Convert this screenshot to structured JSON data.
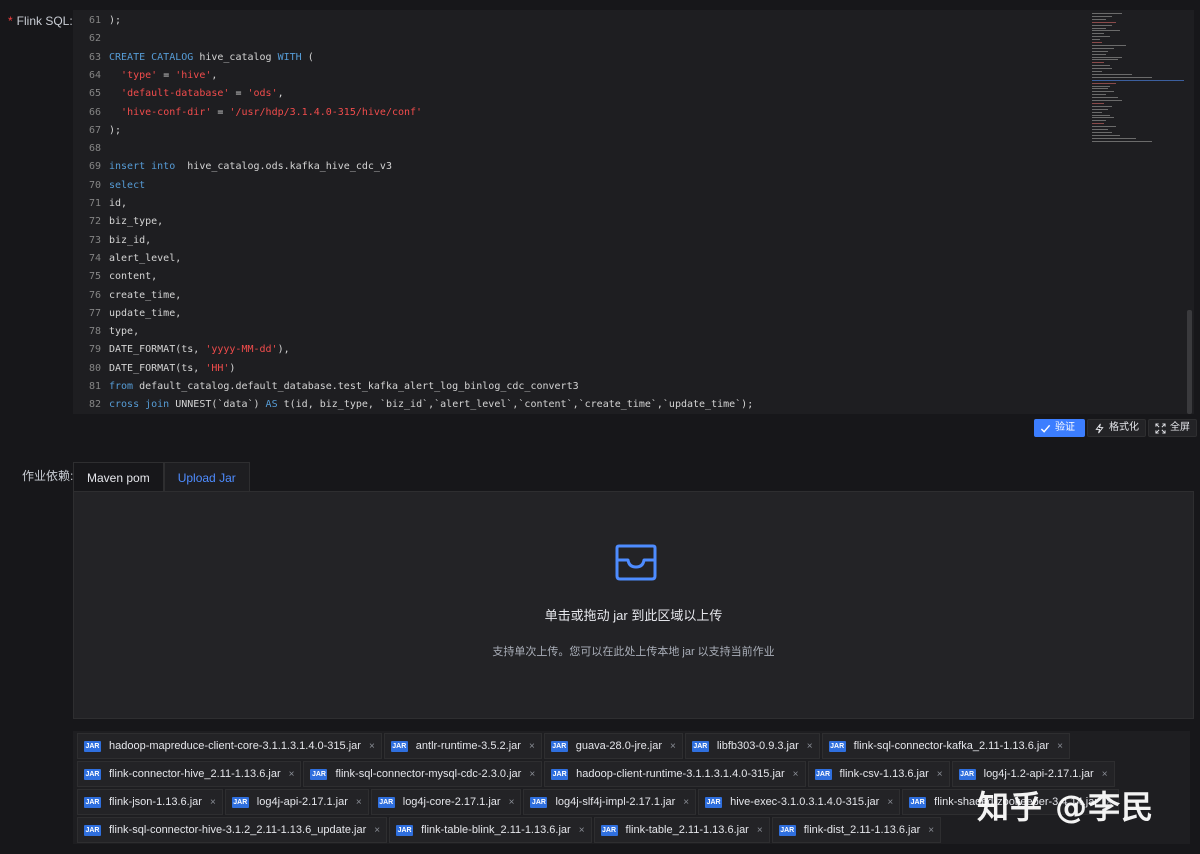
{
  "form": {
    "sql_label": "Flink SQL",
    "sql_required": "*",
    "dependency_label": "作业依赖"
  },
  "editor": {
    "lines": [
      {
        "num": "61",
        "parts": [
          {
            "t": ");",
            "c": ""
          }
        ]
      },
      {
        "num": "62",
        "parts": []
      },
      {
        "num": "63",
        "parts": [
          {
            "t": "CREATE CATALOG",
            "c": "kw"
          },
          {
            "t": " hive_catalog ",
            "c": ""
          },
          {
            "t": "WITH",
            "c": "kw"
          },
          {
            "t": " (",
            "c": ""
          }
        ]
      },
      {
        "num": "64",
        "parts": [
          {
            "t": "  ",
            "c": ""
          },
          {
            "t": "'type'",
            "c": "str"
          },
          {
            "t": " = ",
            "c": ""
          },
          {
            "t": "'hive'",
            "c": "str"
          },
          {
            "t": ",",
            "c": ""
          }
        ]
      },
      {
        "num": "65",
        "parts": [
          {
            "t": "  ",
            "c": ""
          },
          {
            "t": "'default-database'",
            "c": "str"
          },
          {
            "t": " = ",
            "c": ""
          },
          {
            "t": "'ods'",
            "c": "str"
          },
          {
            "t": ",",
            "c": ""
          }
        ]
      },
      {
        "num": "66",
        "parts": [
          {
            "t": "  ",
            "c": ""
          },
          {
            "t": "'hive-conf-dir'",
            "c": "str"
          },
          {
            "t": " = ",
            "c": ""
          },
          {
            "t": "'/usr/hdp/3.1.4.0-315/hive/conf'",
            "c": "str"
          }
        ]
      },
      {
        "num": "67",
        "parts": [
          {
            "t": ");",
            "c": ""
          }
        ]
      },
      {
        "num": "68",
        "parts": []
      },
      {
        "num": "69",
        "parts": [
          {
            "t": "insert into",
            "c": "kw"
          },
          {
            "t": "  hive_catalog.ods.kafka_hive_cdc_v3",
            "c": ""
          }
        ]
      },
      {
        "num": "70",
        "parts": [
          {
            "t": "select",
            "c": "kw"
          }
        ]
      },
      {
        "num": "71",
        "parts": [
          {
            "t": "id,",
            "c": ""
          }
        ]
      },
      {
        "num": "72",
        "parts": [
          {
            "t": "biz_type,",
            "c": ""
          }
        ]
      },
      {
        "num": "73",
        "parts": [
          {
            "t": "biz_id,",
            "c": ""
          }
        ]
      },
      {
        "num": "74",
        "parts": [
          {
            "t": "alert_level,",
            "c": ""
          }
        ]
      },
      {
        "num": "75",
        "parts": [
          {
            "t": "content,",
            "c": ""
          }
        ]
      },
      {
        "num": "76",
        "parts": [
          {
            "t": "create_time,",
            "c": ""
          }
        ]
      },
      {
        "num": "77",
        "parts": [
          {
            "t": "update_time,",
            "c": ""
          }
        ]
      },
      {
        "num": "78",
        "parts": [
          {
            "t": "type,",
            "c": ""
          }
        ]
      },
      {
        "num": "79",
        "parts": [
          {
            "t": "DATE_FORMAT(ts, ",
            "c": ""
          },
          {
            "t": "'yyyy-MM-dd'",
            "c": "str"
          },
          {
            "t": "),",
            "c": ""
          }
        ]
      },
      {
        "num": "80",
        "parts": [
          {
            "t": "DATE_FORMAT(ts, ",
            "c": ""
          },
          {
            "t": "'HH'",
            "c": "str"
          },
          {
            "t": ")",
            "c": ""
          }
        ]
      },
      {
        "num": "81",
        "parts": [
          {
            "t": "from",
            "c": "kw"
          },
          {
            "t": " default_catalog.default_database.test_kafka_alert_log_binlog_cdc_convert3",
            "c": ""
          }
        ]
      },
      {
        "num": "82",
        "parts": [
          {
            "t": "cross join",
            "c": "kw"
          },
          {
            "t": " UNNEST(`data`) ",
            "c": ""
          },
          {
            "t": "AS",
            "c": "kw"
          },
          {
            "t": " t(id, biz_type, `biz_id`,`alert_level`,`content`,`create_time`,`update_time`);",
            "c": ""
          }
        ]
      }
    ]
  },
  "actions": {
    "validate": "验证",
    "format": "格式化",
    "fullscreen": "全屏"
  },
  "tabs": [
    {
      "label": "Maven pom",
      "active": false
    },
    {
      "label": "Upload Jar",
      "active": true
    }
  ],
  "dropzone": {
    "title": "单击或拖动 jar 到此区域以上传",
    "hint": "支持单次上传。您可以在此处上传本地 jar 以支持当前作业"
  },
  "jar_badge": "JAR",
  "files": [
    [
      "hadoop-mapreduce-client-core-3.1.1.3.1.4.0-315.jar",
      "antlr-runtime-3.5.2.jar",
      "guava-28.0-jre.jar",
      "libfb303-0.9.3.jar",
      "flink-sql-connector-kafka_2.11-1.13.6.jar"
    ],
    [
      "flink-connector-hive_2.11-1.13.6.jar",
      "flink-sql-connector-mysql-cdc-2.3.0.jar",
      "hadoop-client-runtime-3.1.1.3.1.4.0-315.jar",
      "flink-csv-1.13.6.jar",
      "log4j-1.2-api-2.17.1.jar"
    ],
    [
      "flink-json-1.13.6.jar",
      "log4j-api-2.17.1.jar",
      "log4j-core-2.17.1.jar",
      "log4j-slf4j-impl-2.17.1.jar",
      "hive-exec-3.1.0.3.1.4.0-315.jar",
      "flink-shaded-zookeeper-3.4.14.jar"
    ],
    [
      "flink-sql-connector-hive-3.1.2_2.11-1.13.6_update.jar",
      "flink-table-blink_2.11-1.13.6.jar",
      "flink-table_2.11-1.13.6.jar",
      "flink-dist_2.11-1.13.6.jar"
    ]
  ],
  "watermark": "知乎 @李民"
}
